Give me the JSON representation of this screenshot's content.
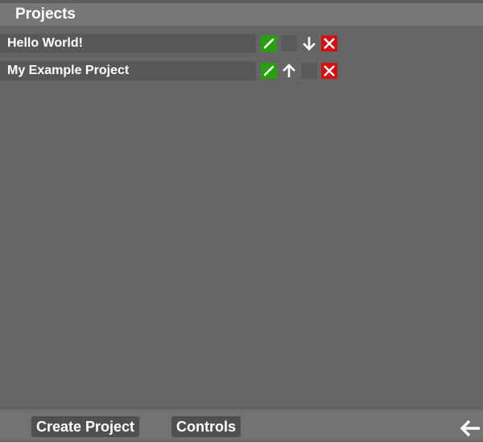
{
  "header": {
    "title": "Projects"
  },
  "projects": [
    {
      "name": "Hello World!",
      "actions": [
        "pencil-icon",
        "empty",
        "arrow-down-icon",
        "close-icon"
      ]
    },
    {
      "name": "My Example Project",
      "actions": [
        "pencil-icon",
        "arrow-up-icon",
        "empty",
        "close-icon"
      ]
    }
  ],
  "footer": {
    "create_project_label": "Create Project",
    "controls_label": "Controls",
    "back_icon": "arrow-left-icon"
  },
  "colors": {
    "background": "#656565",
    "header": "#777777",
    "row": "#585858",
    "edit_button": "#27a10b",
    "delete_button": "#d40f0f",
    "footer": "#727272",
    "footer_button": "#4f4f4f"
  }
}
